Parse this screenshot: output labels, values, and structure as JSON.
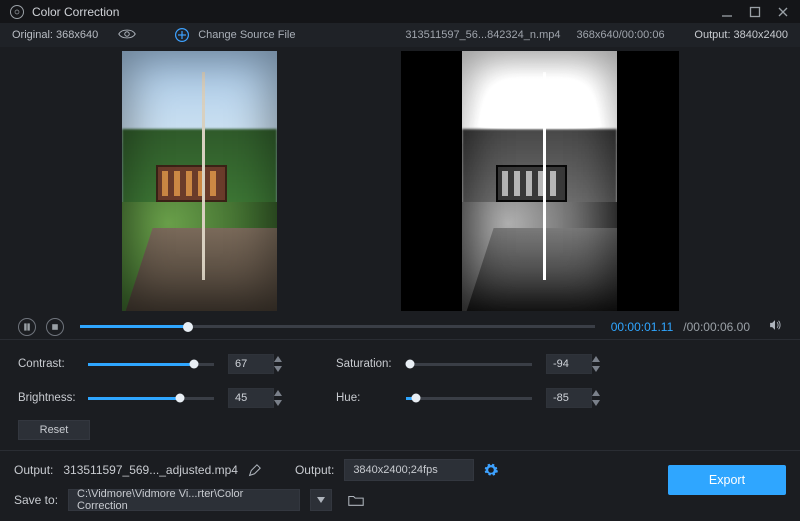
{
  "titlebar": {
    "app_title": "Color Correction"
  },
  "infobar": {
    "original_label": "Original: 368x640",
    "change_source_label": "Change Source File",
    "file_name": "313511597_56...842324_n.mp4",
    "file_meta": "368x640/00:00:06",
    "output_label": "Output: 3840x2400"
  },
  "transport": {
    "timeline_progress_pct": 21,
    "time_current": "00:00:01.11",
    "time_duration": "/00:00:06.00"
  },
  "sliders": {
    "contrast": {
      "label": "Contrast:",
      "value": "67",
      "pct": 84
    },
    "brightness": {
      "label": "Brightness:",
      "value": "45",
      "pct": 73
    },
    "saturation": {
      "label": "Saturation:",
      "value": "-94",
      "pct": 3
    },
    "hue": {
      "label": "Hue:",
      "value": "-85",
      "pct": 8
    }
  },
  "reset": {
    "label": "Reset"
  },
  "bottom": {
    "output_file_label": "Output:",
    "output_file_value": "313511597_569..._adjusted.mp4",
    "output_fmt_label": "Output:",
    "output_fmt_value": "3840x2400;24fps",
    "saveto_label": "Save to:",
    "saveto_value": "C:\\Vidmore\\Vidmore Vi...rter\\Color Correction",
    "export_label": "Export"
  }
}
